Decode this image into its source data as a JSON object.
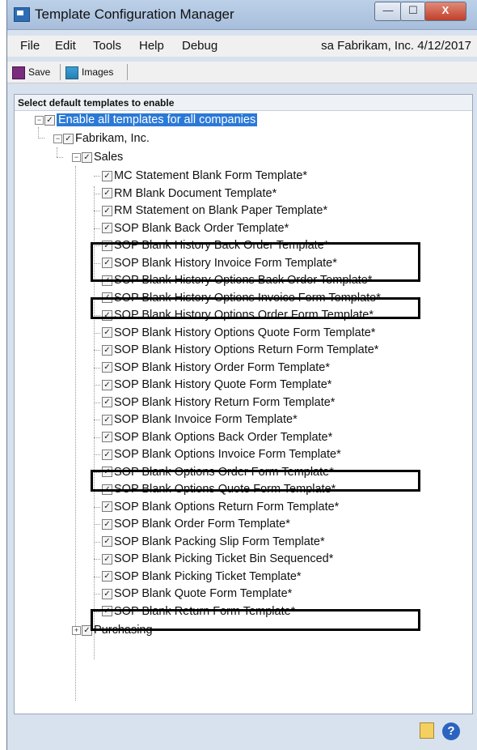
{
  "window": {
    "title": "Template Configuration Manager"
  },
  "menu": [
    "File",
    "Edit",
    "Tools",
    "Help",
    "Debug"
  ],
  "status": "sa  Fabrikam, Inc.  4/12/2017",
  "toolbar": {
    "save": "Save",
    "images": "Images"
  },
  "panel": {
    "header": "Select default templates to enable"
  },
  "tree": {
    "root": "Enable all templates for all companies",
    "company": "Fabrikam, Inc.",
    "module": "Sales",
    "templates": [
      "MC Statement Blank Form Template*",
      "RM Blank Document Template*",
      "RM Statement on Blank Paper Template*",
      "SOP Blank Back Order Template*",
      "SOP Blank History Back Order Template*",
      "SOP Blank History Invoice Form Template*",
      "SOP Blank History Options Back Order Template*",
      "SOP Blank History Options Invoice Form Template*",
      "SOP Blank History Options Order Form Template*",
      "SOP Blank History Options Quote Form Template*",
      "SOP Blank History Options Return Form Template*",
      "SOP Blank History Order Form Template*",
      "SOP Blank History Quote Form Template*",
      "SOP Blank History Return Form Template*",
      "SOP Blank Invoice Form Template*",
      "SOP Blank Options Back Order Template*",
      "SOP Blank Options Invoice Form Template*",
      "SOP Blank Options Order Form Template*",
      "SOP Blank Options Quote Form Template*",
      "SOP Blank Options Return Form Template*",
      "SOP Blank Order Form Template*",
      "SOP Blank Packing Slip Form Template*",
      "SOP Blank Picking Ticket Bin Sequenced*",
      "SOP Blank Picking Ticket Template*",
      "SOP Blank Quote Form Template*",
      "SOP Blank Return Form Template*"
    ],
    "module2": "Purchasing"
  },
  "icons": {
    "app": "template-icon",
    "save": "save-icon",
    "images": "images-icon",
    "note": "note-icon",
    "help": "help-icon"
  }
}
